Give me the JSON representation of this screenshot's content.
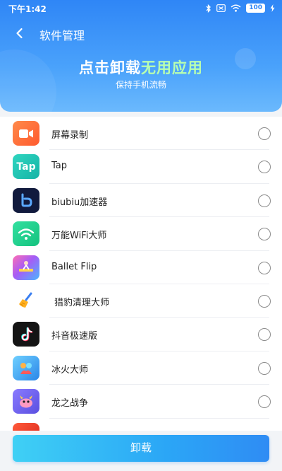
{
  "status_bar": {
    "time": "下午1:42",
    "battery": "100"
  },
  "header": {
    "title": "软件管理",
    "headline_white": "点击卸载",
    "headline_accent": "无用应用",
    "subtitle": "保持手机流畅"
  },
  "apps": [
    {
      "name": "屏幕录制",
      "icon": "screen-recorder-icon",
      "color": "#ff6a3d"
    },
    {
      "name": "Tap",
      "icon": "tap-icon",
      "color": "#21c4b0"
    },
    {
      "name": "biubiu加速器",
      "icon": "biubiu-icon",
      "color": "#14204a"
    },
    {
      "name": "万能WiFi大师",
      "icon": "wifi-icon",
      "color": "#1ecf8a"
    },
    {
      "name": "Ballet Flip",
      "icon": "ballet-flip-icon",
      "color": "#9b5cf6"
    },
    {
      "name": "猎豹清理大师",
      "icon": "broom-icon",
      "color": "#ffffff"
    },
    {
      "name": "抖音极速版",
      "icon": "douyin-icon",
      "color": "#111111"
    },
    {
      "name": "冰火大师",
      "icon": "ice-fire-icon",
      "color": "#3aa7f0"
    },
    {
      "name": "龙之战争",
      "icon": "dragon-icon",
      "color": "#6f6cf0"
    }
  ],
  "footer": {
    "uninstall_label": "卸载"
  }
}
